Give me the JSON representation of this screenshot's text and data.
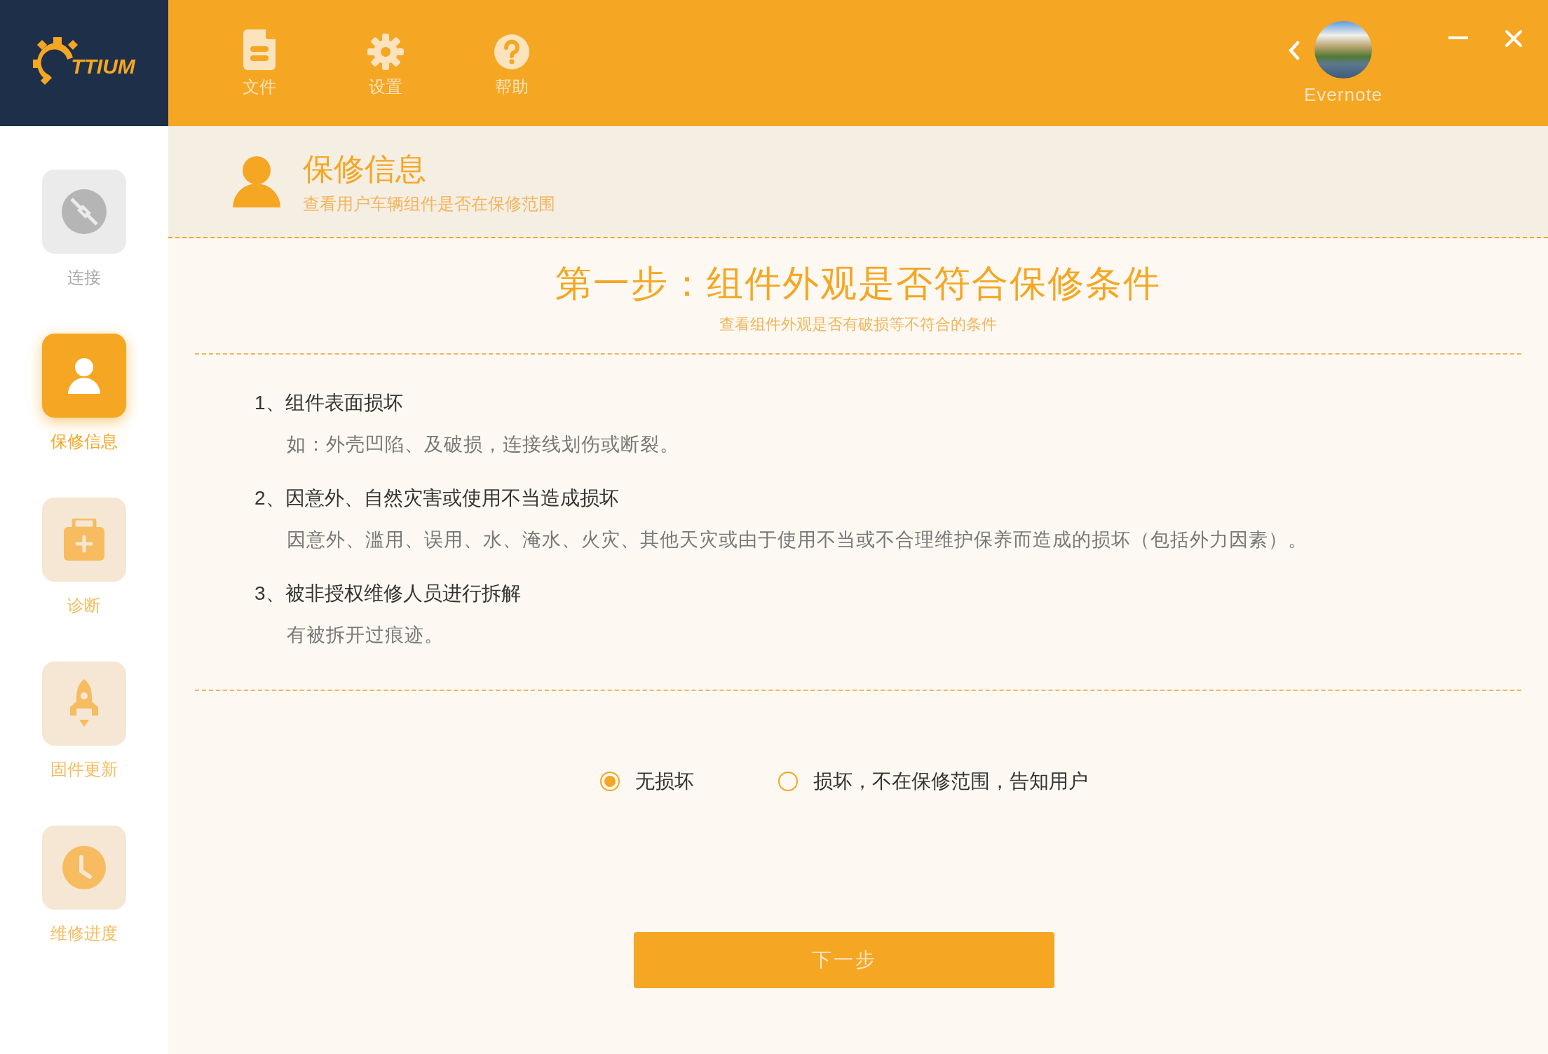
{
  "logo": {
    "text": "TTIUM"
  },
  "toolbar": [
    {
      "label": "文件"
    },
    {
      "label": "设置"
    },
    {
      "label": "帮助"
    }
  ],
  "user": {
    "name": "Evernote"
  },
  "sidebar": {
    "items": [
      {
        "label": "连接",
        "selected": false,
        "disabled": true
      },
      {
        "label": "保修信息",
        "selected": true,
        "disabled": false
      },
      {
        "label": "诊断",
        "selected": false,
        "disabled": false
      },
      {
        "label": "固件更新",
        "selected": false,
        "disabled": false
      },
      {
        "label": "维修进度",
        "selected": false,
        "disabled": false
      }
    ]
  },
  "header": {
    "title": "保修信息",
    "subtitle": "查看用户车辆组件是否在保修范围"
  },
  "step": {
    "title": "第一步：组件外观是否符合保修条件",
    "subtitle": "查看组件外观是否有破损等不符合的条件"
  },
  "conditions": [
    {
      "title": "1、组件表面损坏",
      "description": "如：外壳凹陷、及破损，连接线划伤或断裂。"
    },
    {
      "title": "2、因意外、自然灾害或使用不当造成损坏",
      "description": "因意外、滥用、误用、水、淹水、火灾、其他天灾或由于使用不当或不合理维护保养而造成的损坏（包括外力因素）。"
    },
    {
      "title": "3、被非授权维修人员进行拆解",
      "description": "有被拆开过痕迹。"
    }
  ],
  "options": [
    {
      "label": "无损坏",
      "selected": true
    },
    {
      "label": "损坏，不在保修范围，告知用户",
      "selected": false
    }
  ],
  "next_button": {
    "label": "下一步"
  }
}
